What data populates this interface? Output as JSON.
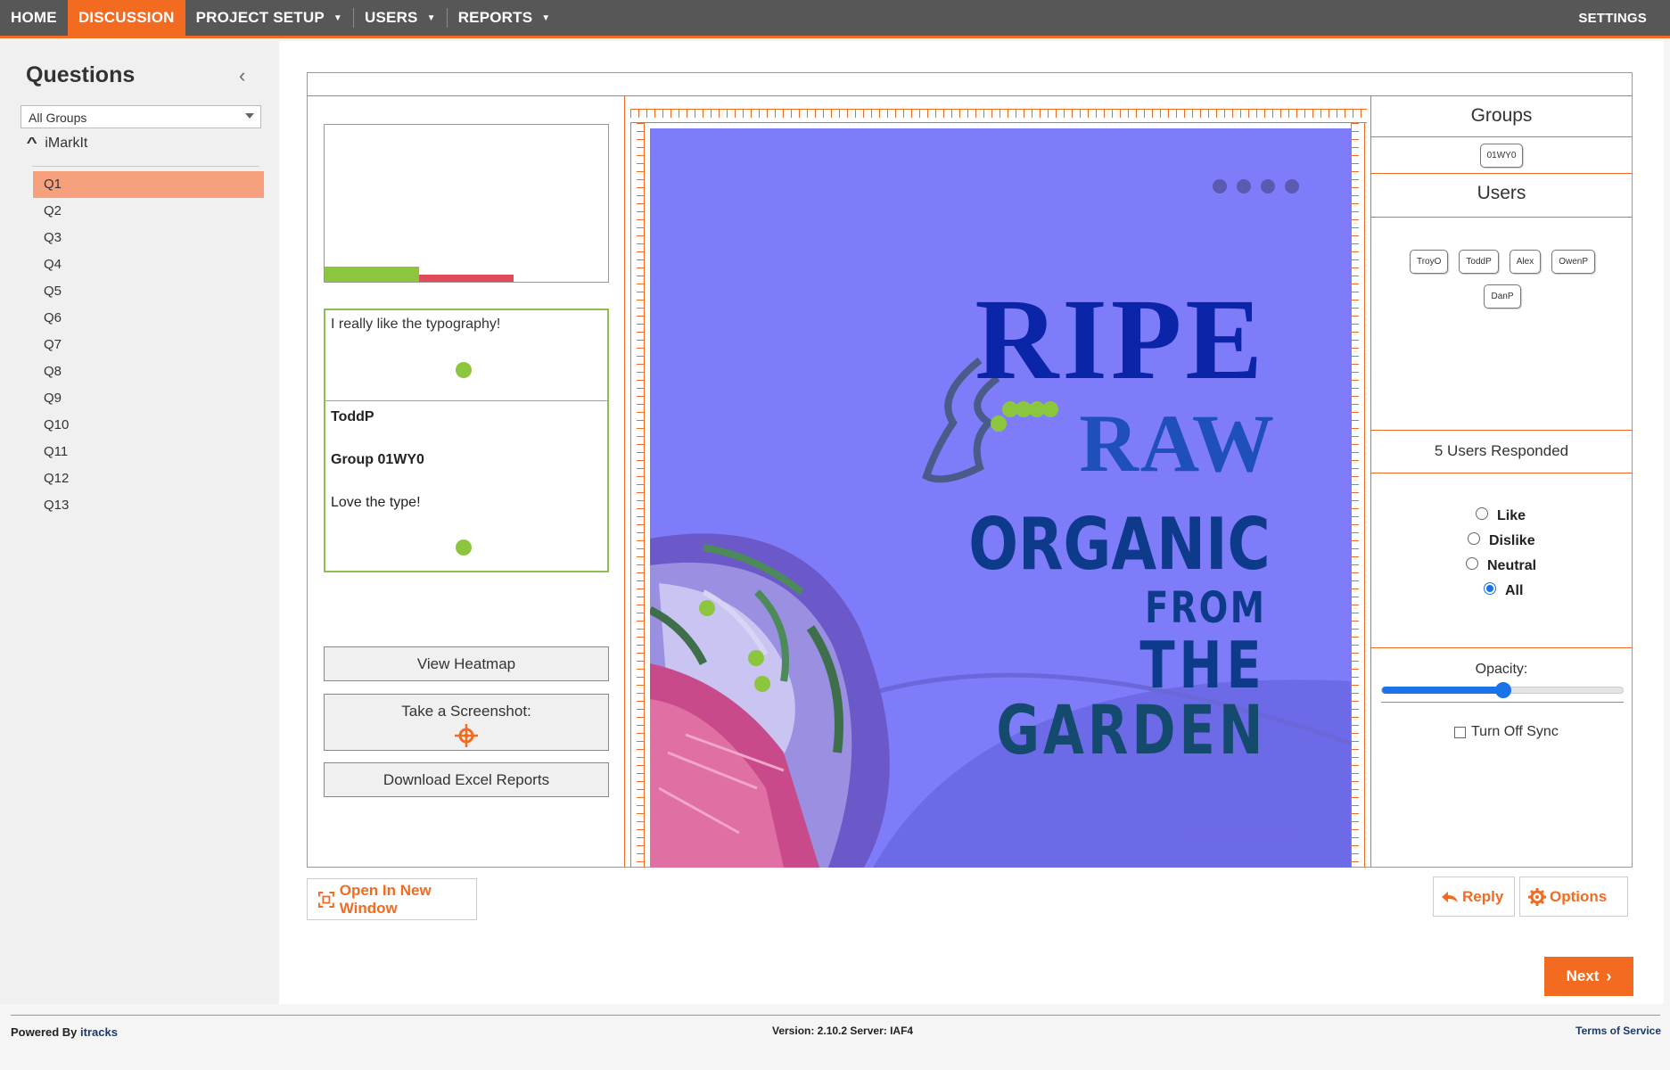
{
  "nav": {
    "home": "HOME",
    "discussion": "DISCUSSION",
    "project_setup": "PROJECT SETUP",
    "users": "USERS",
    "reports": "REPORTS",
    "settings": "SETTINGS",
    "accent_color": "#f26b21"
  },
  "sidebar": {
    "title": "Questions",
    "group_select": "All Groups",
    "group_name": "iMarkIt",
    "questions": [
      "Q1",
      "Q2",
      "Q3",
      "Q4",
      "Q5",
      "Q6",
      "Q7",
      "Q8",
      "Q9",
      "Q10",
      "Q11",
      "Q12",
      "Q13"
    ],
    "active_index": 0
  },
  "comment": {
    "text": "I really like the typography!",
    "reply_user": "ToddP",
    "reply_group": "Group 01WY0",
    "reply_text": "Love the type!"
  },
  "actions": {
    "view_heatmap": "View Heatmap",
    "take_screenshot": "Take a Screenshot:",
    "download_excel": "Download Excel Reports",
    "open_new_window": "Open In New Window",
    "reply": "Reply",
    "options": "Options",
    "next": "Next"
  },
  "poster": {
    "line1": "RIPE",
    "line2": "RAW",
    "line3": "ORGANIC",
    "line4": "FROM",
    "line5": "THE",
    "line6": "GARDEN",
    "background_color": "#7f7cf9"
  },
  "right_panel": {
    "groups_title": "Groups",
    "groups": [
      "01WY0"
    ],
    "users_title": "Users",
    "users": [
      "TroyO",
      "ToddP",
      "Alex",
      "OwenP",
      "DanP"
    ],
    "responded": "5 Users Responded",
    "filters": [
      "Like",
      "Dislike",
      "Neutral",
      "All"
    ],
    "selected_filter": "All",
    "opacity_label": "Opacity:",
    "opacity_value": 0.5,
    "sync_label": "Turn Off Sync",
    "sync_checked": false
  },
  "chart_data": {
    "type": "bar",
    "categories": [
      "Like",
      "Dislike"
    ],
    "values": [
      1,
      1
    ],
    "colors": [
      "#8cc63f",
      "#e04b5a"
    ]
  },
  "footer": {
    "powered_by": "Powered By",
    "brand": "itracks",
    "version": "Version: 2.10.2  Server: IAF4",
    "terms": "Terms of Service"
  }
}
